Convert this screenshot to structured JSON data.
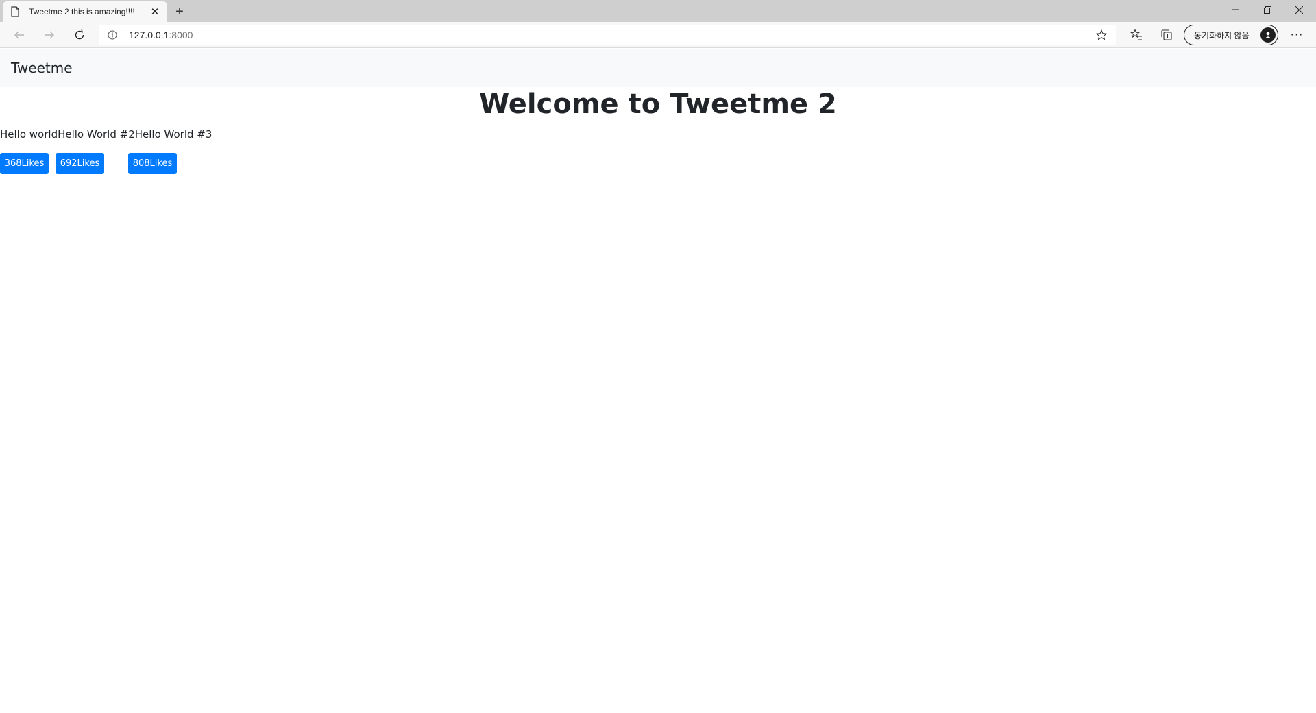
{
  "browser": {
    "tab": {
      "title": "Tweetme 2 this is amazing!!!!"
    },
    "address": {
      "host": "127.0.0.1",
      "port": ":8000"
    },
    "profile": {
      "label": "동기화하지 않음"
    },
    "icons": {
      "favicon": "page-icon",
      "close": "close-icon",
      "new_tab": "plus-icon",
      "back": "back-arrow-icon",
      "forward": "forward-arrow-icon",
      "refresh": "refresh-icon",
      "info": "info-icon",
      "favorite": "star-icon",
      "favorites_list": "favorites-icon",
      "collections": "collections-icon",
      "more": "more-icon"
    }
  },
  "page": {
    "brand": "Tweetme",
    "heading": "Welcome to Tweetme 2",
    "tweets_text": "Hello worldHello World #2Hello World #3",
    "likes": [
      {
        "label": "368Likes",
        "count": 368
      },
      {
        "label": "692Likes",
        "count": 692
      },
      {
        "label": "808Likes",
        "count": 808
      }
    ],
    "colors": {
      "button": "#007bff",
      "navbar": "#f8f9fa",
      "text": "#212529"
    }
  }
}
